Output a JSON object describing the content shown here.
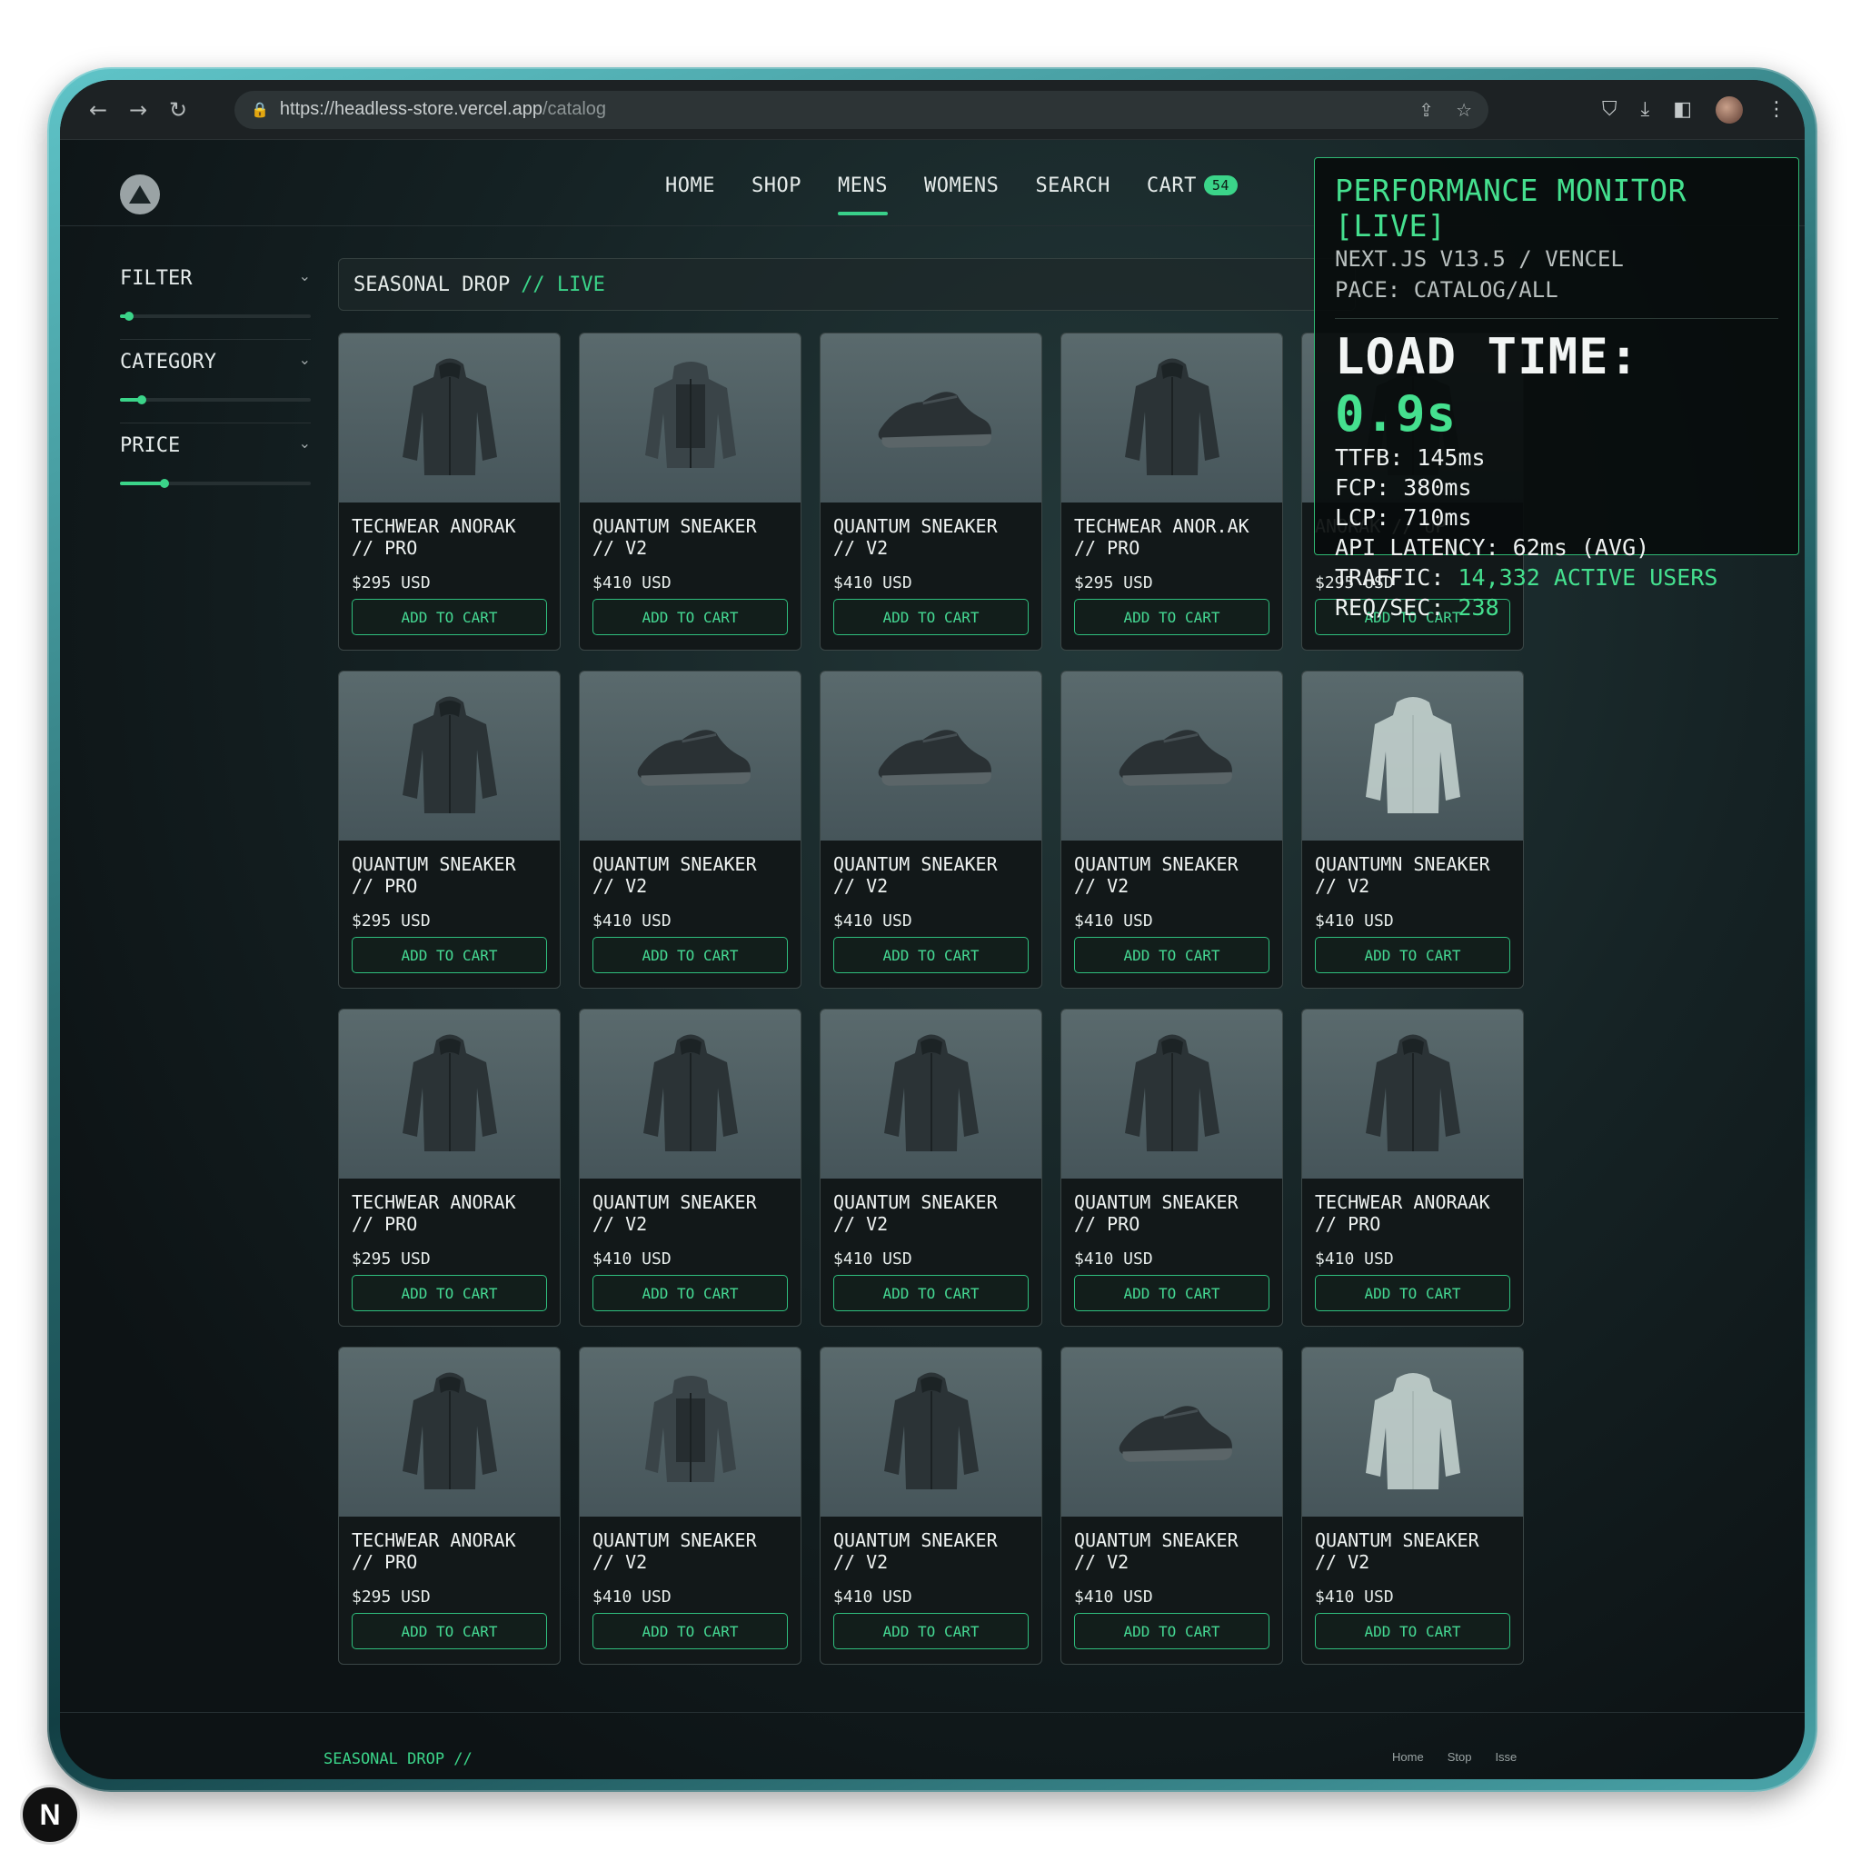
{
  "browser": {
    "url_host": "https://headless-store.vercel.app",
    "url_path": "/catalog"
  },
  "nav": {
    "items": [
      {
        "label": "HOME"
      },
      {
        "label": "SHOP"
      },
      {
        "label": "MENS"
      },
      {
        "label": "WOMENS"
      },
      {
        "label": "SEARCH"
      },
      {
        "label": "CART"
      }
    ],
    "active": "MENS",
    "cart_count": "54"
  },
  "sidebar": {
    "filters": [
      {
        "label": "FILTER",
        "level": 0.05
      },
      {
        "label": "CATEGORY",
        "level": 0.12
      },
      {
        "label": "PRICE",
        "level": 0.24
      }
    ]
  },
  "banner": {
    "title": "SEASONAL DROP",
    "live": "// LIVE"
  },
  "products": [
    {
      "name": "TECHWEAR ANORAK // PRO",
      "price": "$295 USD",
      "icon": "jacket",
      "btn": "ADD TO CART"
    },
    {
      "name": "QUANTUM SNEAKER // V2",
      "price": "$410 USD",
      "icon": "vest-jacket",
      "btn": "ADD TO CART"
    },
    {
      "name": "QUANTUM SNEAKER // V2",
      "price": "$410 USD",
      "icon": "sneaker",
      "btn": "ADD TO CART"
    },
    {
      "name": "TECHWEAR ANOR.AK // PRO",
      "price": "$295 USD",
      "icon": "jacket",
      "btn": "ADD TO CART"
    },
    {
      "name": "ANORAK // UP",
      "price": "$295 USD",
      "icon": "jacket",
      "btn": "ADD TO CART"
    },
    {
      "name": "QUANTUM SNEAKER // PRO",
      "price": "$295 USD",
      "icon": "jacket",
      "btn": "ADD TO CART"
    },
    {
      "name": "QUANTUM SNEAKER // V2",
      "price": "$410 USD",
      "icon": "sneaker",
      "btn": "ADD TO CART"
    },
    {
      "name": "QUANTUM SNEAKER // V2",
      "price": "$410 USD",
      "icon": "sneaker",
      "btn": "ADD TO CART"
    },
    {
      "name": "QUANTUM SNEAKER // V2",
      "price": "$410 USD",
      "icon": "sneaker",
      "btn": "ADD TO CART"
    },
    {
      "name": "QUANTUMN SNEAKER // V2",
      "price": "$410 USD",
      "icon": "white-jacket",
      "btn": "ADD TO CART"
    },
    {
      "name": "TECHWEAR ANORAK // PRO",
      "price": "$295 USD",
      "icon": "jacket",
      "btn": "ADD TO CART"
    },
    {
      "name": "QUANTUM SNEAKER // V2",
      "price": "$410 USD",
      "icon": "jacket",
      "btn": "ADD TO CART"
    },
    {
      "name": "QUANTUM SNEAKER // V2",
      "price": "$410 USD",
      "icon": "jacket",
      "btn": "ADD TO CART"
    },
    {
      "name": "QUANTUM SNEAKER // PRO",
      "price": "$410 USD",
      "icon": "jacket",
      "btn": "ADD TO CART"
    },
    {
      "name": "TECHWEAR ANORAAK // PRO",
      "price": "$410 USD",
      "icon": "jacket",
      "btn": "ADD TO CART"
    },
    {
      "name": "TECHWEAR ANORAK // PRO",
      "price": "$295 USD",
      "icon": "jacket",
      "btn": "ADD TO CART"
    },
    {
      "name": "QUANTUM SNEAKER // V2",
      "price": "$410 USD",
      "icon": "vest-jacket",
      "btn": "ADD TO CART"
    },
    {
      "name": "QUANTUM SNEAKER // V2",
      "price": "$410 USD",
      "icon": "jacket",
      "btn": "ADD TO CART"
    },
    {
      "name": "QUANTUM SNEAKER // V2",
      "price": "$410 USD",
      "icon": "sneaker",
      "btn": "ADD TO CART"
    },
    {
      "name": "QUANTUM SNEAKER // V2",
      "price": "$410 USD",
      "icon": "white-jacket",
      "btn": "ADD TO CART"
    }
  ],
  "perf": {
    "title": "PERFORMANCE MONITOR [LIVE]",
    "line1": "NEXT.JS V13.5 / VENCEL",
    "line2": "PACE: CATALOG/ALL",
    "load_label": "LOAD TIME:",
    "load_value": "0.9s",
    "ttfb": "TTFB: 145ms",
    "fcp": "FCP: 380ms",
    "lcp": "LCP: 710ms",
    "api": "API LATENCY: 62ms (AVG)",
    "traffic_label": "TRAFFIC:",
    "traffic_value": "14,332 ACTIVE USERS",
    "req_label": "REQ/SEC:",
    "req_value": "238"
  },
  "footer": {
    "left": "SEASONAL DROP //",
    "links": [
      "Home",
      "Stop",
      "Isse"
    ]
  },
  "colors": {
    "accent": "#3bd489",
    "background": "#121819",
    "frame": "#2b6f73"
  }
}
